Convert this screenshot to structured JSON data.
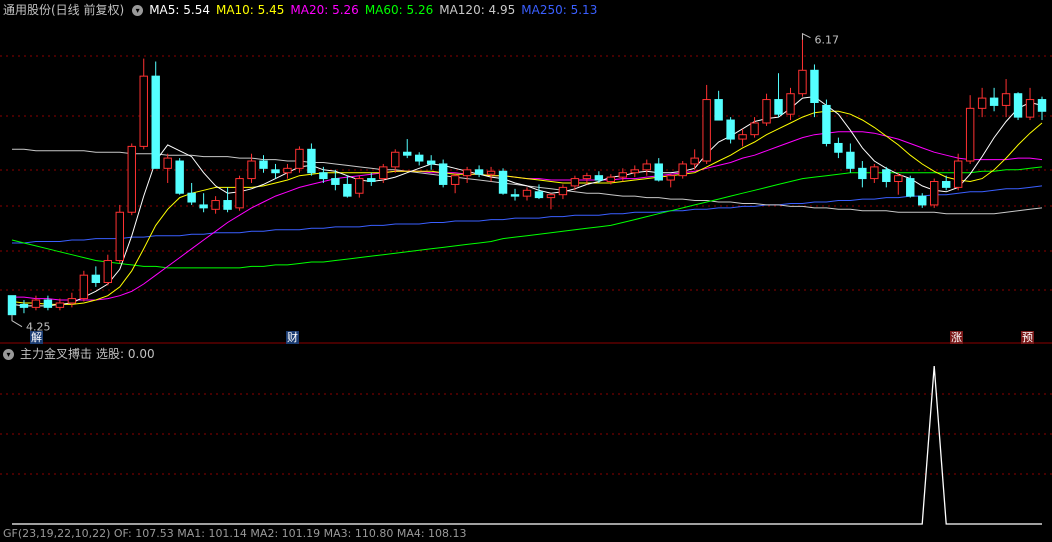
{
  "header": {
    "stock_title": "通用股份(日线 前复权)",
    "ma_labels": [
      {
        "text": "MA5: 5.54",
        "color": "#ffffff"
      },
      {
        "text": "MA10: 5.45",
        "color": "#ffff00"
      },
      {
        "text": "MA20: 5.26",
        "color": "#ff00ff"
      },
      {
        "text": "MA60: 5.26",
        "color": "#00ff00"
      },
      {
        "text": "MA120: 4.95",
        "color": "#c8c8c8"
      },
      {
        "text": "MA250: 5.13",
        "color": "#3a5fff"
      }
    ]
  },
  "indicator": {
    "title": "主力金叉搏击",
    "value_text": "选股: 0.00"
  },
  "bottom_text": "GF(23,19,22,10,22)  OF: 107.53  MA1: 101.14  MA2: 101.19  MA3: 110.80  MA4: 108.13",
  "markers": {
    "jie": "解",
    "cai": "财",
    "zhang": "涨",
    "yu": "预"
  },
  "chart_data": {
    "type": "candlestick",
    "price_high_label": "6.17",
    "price_low_label": "4.25",
    "ylim": [
      4.2,
      6.25
    ],
    "colors": {
      "up": "#ff3232",
      "down": "#54ffff",
      "ma5": "#ffffff",
      "ma10": "#ffff00",
      "ma20": "#ff00ff",
      "ma60": "#00ff00",
      "ma120": "#c8c8c8",
      "ma250": "#3a5fff",
      "grid": "#8b0000"
    },
    "candles": [
      [
        4.38,
        4.38,
        4.25,
        4.25
      ],
      [
        4.32,
        4.35,
        4.26,
        4.3
      ],
      [
        4.3,
        4.38,
        4.28,
        4.35
      ],
      [
        4.35,
        4.38,
        4.28,
        4.3
      ],
      [
        4.3,
        4.36,
        4.28,
        4.33
      ],
      [
        4.33,
        4.4,
        4.3,
        4.36
      ],
      [
        4.36,
        4.55,
        4.34,
        4.52
      ],
      [
        4.52,
        4.58,
        4.44,
        4.47
      ],
      [
        4.47,
        4.66,
        4.45,
        4.62
      ],
      [
        4.62,
        5.0,
        4.6,
        4.95
      ],
      [
        4.95,
        5.42,
        4.93,
        5.4
      ],
      [
        5.4,
        6.0,
        5.38,
        5.88
      ],
      [
        5.88,
        5.98,
        5.25,
        5.25
      ],
      [
        5.25,
        5.35,
        5.15,
        5.32
      ],
      [
        5.3,
        5.32,
        5.07,
        5.08
      ],
      [
        5.08,
        5.15,
        5.0,
        5.02
      ],
      [
        5.0,
        5.08,
        4.95,
        4.98
      ],
      [
        4.97,
        5.06,
        4.94,
        5.03
      ],
      [
        5.03,
        5.12,
        4.95,
        4.97
      ],
      [
        4.98,
        5.2,
        4.96,
        5.18
      ],
      [
        5.18,
        5.35,
        5.15,
        5.3
      ],
      [
        5.3,
        5.34,
        5.22,
        5.25
      ],
      [
        5.24,
        5.28,
        5.18,
        5.22
      ],
      [
        5.22,
        5.28,
        5.18,
        5.25
      ],
      [
        5.25,
        5.4,
        5.22,
        5.38
      ],
      [
        5.38,
        5.42,
        5.2,
        5.22
      ],
      [
        5.22,
        5.26,
        5.15,
        5.18
      ],
      [
        5.18,
        5.24,
        5.1,
        5.14
      ],
      [
        5.14,
        5.2,
        5.05,
        5.06
      ],
      [
        5.08,
        5.2,
        5.05,
        5.18
      ],
      [
        5.18,
        5.22,
        5.13,
        5.16
      ],
      [
        5.18,
        5.28,
        5.15,
        5.26
      ],
      [
        5.26,
        5.38,
        5.22,
        5.36
      ],
      [
        5.36,
        5.45,
        5.32,
        5.34
      ],
      [
        5.34,
        5.36,
        5.27,
        5.3
      ],
      [
        5.3,
        5.34,
        5.24,
        5.28
      ],
      [
        5.28,
        5.31,
        5.12,
        5.14
      ],
      [
        5.14,
        5.22,
        5.08,
        5.2
      ],
      [
        5.2,
        5.26,
        5.15,
        5.24
      ],
      [
        5.24,
        5.27,
        5.19,
        5.21
      ],
      [
        5.21,
        5.26,
        5.16,
        5.23
      ],
      [
        5.23,
        5.25,
        5.07,
        5.08
      ],
      [
        5.07,
        5.11,
        5.03,
        5.06
      ],
      [
        5.06,
        5.12,
        5.03,
        5.1
      ],
      [
        5.09,
        5.14,
        5.04,
        5.05
      ],
      [
        5.05,
        5.08,
        4.97,
        5.07
      ],
      [
        5.07,
        5.14,
        5.04,
        5.12
      ],
      [
        5.13,
        5.2,
        5.1,
        5.18
      ],
      [
        5.18,
        5.22,
        5.14,
        5.2
      ],
      [
        5.2,
        5.23,
        5.15,
        5.17
      ],
      [
        5.16,
        5.21,
        5.14,
        5.19
      ],
      [
        5.19,
        5.25,
        5.16,
        5.22
      ],
      [
        5.22,
        5.27,
        5.19,
        5.24
      ],
      [
        5.24,
        5.31,
        5.2,
        5.28
      ],
      [
        5.28,
        5.32,
        5.16,
        5.17
      ],
      [
        5.17,
        5.21,
        5.12,
        5.2
      ],
      [
        5.2,
        5.3,
        5.18,
        5.28
      ],
      [
        5.28,
        5.38,
        5.24,
        5.32
      ],
      [
        5.3,
        5.82,
        5.28,
        5.72
      ],
      [
        5.72,
        5.78,
        5.58,
        5.58
      ],
      [
        5.58,
        5.6,
        5.42,
        5.45
      ],
      [
        5.45,
        5.52,
        5.4,
        5.48
      ],
      [
        5.48,
        5.6,
        5.46,
        5.56
      ],
      [
        5.56,
        5.76,
        5.54,
        5.72
      ],
      [
        5.72,
        5.9,
        5.6,
        5.62
      ],
      [
        5.62,
        5.8,
        5.58,
        5.76
      ],
      [
        5.76,
        6.17,
        5.74,
        5.92
      ],
      [
        5.92,
        5.96,
        5.6,
        5.7
      ],
      [
        5.68,
        5.72,
        5.4,
        5.42
      ],
      [
        5.42,
        5.46,
        5.32,
        5.36
      ],
      [
        5.36,
        5.42,
        5.22,
        5.25
      ],
      [
        5.25,
        5.3,
        5.12,
        5.18
      ],
      [
        5.18,
        5.28,
        5.15,
        5.26
      ],
      [
        5.24,
        5.26,
        5.12,
        5.16
      ],
      [
        5.16,
        5.22,
        5.07,
        5.2
      ],
      [
        5.18,
        5.2,
        5.05,
        5.06
      ],
      [
        5.06,
        5.08,
        4.98,
        5.0
      ],
      [
        5.0,
        5.18,
        4.98,
        5.16
      ],
      [
        5.16,
        5.2,
        5.1,
        5.12
      ],
      [
        5.12,
        5.35,
        5.1,
        5.3
      ],
      [
        5.3,
        5.75,
        5.28,
        5.66
      ],
      [
        5.66,
        5.8,
        5.6,
        5.73
      ],
      [
        5.73,
        5.8,
        5.64,
        5.68
      ],
      [
        5.68,
        5.86,
        5.6,
        5.76
      ],
      [
        5.76,
        5.77,
        5.58,
        5.6
      ],
      [
        5.6,
        5.8,
        5.58,
        5.72
      ],
      [
        5.72,
        5.74,
        5.58,
        5.64
      ]
    ],
    "ma_series": {
      "ma5": [
        4.32,
        4.31,
        4.31,
        4.31,
        4.32,
        4.33,
        4.37,
        4.41,
        4.46,
        4.56,
        4.79,
        5.06,
        5.3,
        5.41,
        5.37,
        5.33,
        5.22,
        5.13,
        5.08,
        5.09,
        5.11,
        5.14,
        5.18,
        5.22,
        5.26,
        5.27,
        5.24,
        5.23,
        5.2,
        5.17,
        5.16,
        5.17,
        5.19,
        5.22,
        5.25,
        5.28,
        5.27,
        5.25,
        5.23,
        5.21,
        5.19,
        5.18,
        5.15,
        5.13,
        5.1,
        5.08,
        5.09,
        5.11,
        5.14,
        5.16,
        5.19,
        5.2,
        5.22,
        5.23,
        5.22,
        5.22,
        5.23,
        5.25,
        5.35,
        5.43,
        5.47,
        5.52,
        5.57,
        5.59,
        5.6,
        5.66,
        5.73,
        5.74,
        5.68,
        5.62,
        5.51,
        5.39,
        5.3,
        5.25,
        5.21,
        5.18,
        5.13,
        5.1,
        5.09,
        5.12,
        5.21,
        5.33,
        5.46,
        5.57,
        5.66,
        5.7,
        5.68
      ],
      "ma10": [
        4.34,
        4.33,
        4.33,
        4.32,
        4.32,
        4.32,
        4.33,
        4.35,
        4.38,
        4.44,
        4.55,
        4.7,
        4.86,
        4.97,
        5.05,
        5.08,
        5.1,
        5.12,
        5.12,
        5.12,
        5.12,
        5.13,
        5.15,
        5.17,
        5.2,
        5.21,
        5.22,
        5.22,
        5.22,
        5.22,
        5.22,
        5.22,
        5.23,
        5.23,
        5.23,
        5.23,
        5.22,
        5.21,
        5.21,
        5.21,
        5.2,
        5.2,
        5.19,
        5.18,
        5.17,
        5.16,
        5.15,
        5.15,
        5.15,
        5.15,
        5.15,
        5.16,
        5.17,
        5.18,
        5.19,
        5.2,
        5.21,
        5.22,
        5.26,
        5.3,
        5.34,
        5.39,
        5.43,
        5.48,
        5.52,
        5.56,
        5.6,
        5.63,
        5.64,
        5.64,
        5.62,
        5.58,
        5.53,
        5.47,
        5.41,
        5.34,
        5.28,
        5.23,
        5.19,
        5.17,
        5.16,
        5.18,
        5.24,
        5.32,
        5.41,
        5.49,
        5.56
      ],
      "ma20": [
        4.37,
        4.37,
        4.36,
        4.36,
        4.35,
        4.35,
        4.35,
        4.35,
        4.36,
        4.38,
        4.41,
        4.46,
        4.52,
        4.58,
        4.64,
        4.7,
        4.76,
        4.82,
        4.88,
        4.93,
        4.98,
        5.02,
        5.06,
        5.09,
        5.12,
        5.14,
        5.16,
        5.18,
        5.19,
        5.2,
        5.21,
        5.22,
        5.23,
        5.23,
        5.23,
        5.22,
        5.22,
        5.22,
        5.21,
        5.21,
        5.2,
        5.2,
        5.19,
        5.18,
        5.18,
        5.17,
        5.17,
        5.17,
        5.17,
        5.17,
        5.17,
        5.18,
        5.18,
        5.19,
        5.2,
        5.21,
        5.22,
        5.23,
        5.25,
        5.27,
        5.29,
        5.32,
        5.34,
        5.37,
        5.4,
        5.43,
        5.46,
        5.48,
        5.49,
        5.5,
        5.5,
        5.5,
        5.49,
        5.47,
        5.45,
        5.42,
        5.39,
        5.36,
        5.34,
        5.32,
        5.31,
        5.31,
        5.31,
        5.31,
        5.32,
        5.32,
        5.31
      ],
      "ma60": [
        4.76,
        4.74,
        4.72,
        4.7,
        4.68,
        4.66,
        4.64,
        4.62,
        4.61,
        4.6,
        4.59,
        4.58,
        4.58,
        4.57,
        4.57,
        4.57,
        4.57,
        4.57,
        4.57,
        4.57,
        4.58,
        4.58,
        4.59,
        4.59,
        4.6,
        4.61,
        4.61,
        4.62,
        4.63,
        4.64,
        4.65,
        4.66,
        4.67,
        4.68,
        4.69,
        4.7,
        4.71,
        4.72,
        4.73,
        4.74,
        4.75,
        4.77,
        4.78,
        4.79,
        4.8,
        4.81,
        4.82,
        4.83,
        4.84,
        4.85,
        4.86,
        4.88,
        4.9,
        4.92,
        4.94,
        4.96,
        4.98,
        5.0,
        5.02,
        5.04,
        5.06,
        5.08,
        5.1,
        5.12,
        5.14,
        5.16,
        5.18,
        5.19,
        5.2,
        5.21,
        5.22,
        5.22,
        5.22,
        5.22,
        5.22,
        5.22,
        5.22,
        5.22,
        5.22,
        5.22,
        5.22,
        5.23,
        5.23,
        5.24,
        5.24,
        5.25,
        5.26
      ],
      "ma120": [
        5.38,
        5.38,
        5.37,
        5.37,
        5.37,
        5.37,
        5.37,
        5.36,
        5.36,
        5.36,
        5.35,
        5.35,
        5.35,
        5.34,
        5.34,
        5.34,
        5.33,
        5.33,
        5.33,
        5.32,
        5.32,
        5.31,
        5.31,
        5.3,
        5.3,
        5.29,
        5.29,
        5.28,
        5.27,
        5.26,
        5.25,
        5.24,
        5.24,
        5.23,
        5.22,
        5.21,
        5.2,
        5.19,
        5.18,
        5.17,
        5.16,
        5.15,
        5.14,
        5.13,
        5.12,
        5.11,
        5.1,
        5.09,
        5.08,
        5.08,
        5.07,
        5.06,
        5.06,
        5.05,
        5.05,
        5.04,
        5.04,
        5.03,
        5.03,
        5.02,
        5.02,
        5.01,
        5.01,
        5.0,
        5.0,
        4.99,
        4.99,
        4.98,
        4.98,
        4.97,
        4.97,
        4.96,
        4.96,
        4.96,
        4.95,
        4.95,
        4.95,
        4.95,
        4.94,
        4.94,
        4.94,
        4.94,
        4.94,
        4.95,
        4.96,
        4.97,
        4.98
      ],
      "ma250": [
        4.74,
        4.74,
        4.75,
        4.75,
        4.75,
        4.76,
        4.76,
        4.77,
        4.77,
        4.77,
        4.78,
        4.78,
        4.79,
        4.79,
        4.79,
        4.8,
        4.8,
        4.81,
        4.81,
        4.81,
        4.82,
        4.82,
        4.83,
        4.83,
        4.83,
        4.84,
        4.84,
        4.85,
        4.85,
        4.85,
        4.86,
        4.86,
        4.87,
        4.87,
        4.87,
        4.88,
        4.88,
        4.89,
        4.89,
        4.89,
        4.9,
        4.9,
        4.91,
        4.91,
        4.91,
        4.92,
        4.92,
        4.93,
        4.93,
        4.93,
        4.94,
        4.94,
        4.95,
        4.95,
        4.95,
        4.96,
        4.96,
        4.97,
        4.97,
        4.98,
        4.98,
        4.99,
        4.99,
        5.0,
        5.0,
        5.01,
        5.01,
        5.02,
        5.02,
        5.03,
        5.03,
        5.04,
        5.04,
        5.05,
        5.05,
        5.06,
        5.06,
        5.07,
        5.07,
        5.08,
        5.09,
        5.09,
        5.1,
        5.11,
        5.11,
        5.12,
        5.13
      ]
    },
    "indicator_series": [
      0,
      0,
      0,
      0,
      0,
      0,
      0,
      0,
      0,
      0,
      0,
      0,
      0,
      0,
      0,
      0,
      0,
      0,
      0,
      0,
      0,
      0,
      0,
      0,
      0,
      0,
      0,
      0,
      0,
      0,
      0,
      0,
      0,
      0,
      0,
      0,
      0,
      0,
      0,
      0,
      0,
      0,
      0,
      0,
      0,
      0,
      0,
      0,
      0,
      0,
      0,
      0,
      0,
      0,
      0,
      0,
      0,
      0,
      0,
      0,
      0,
      0,
      0,
      0,
      0,
      0,
      0,
      0,
      0,
      0,
      0,
      0,
      0,
      0,
      0,
      0,
      0,
      1,
      0,
      0,
      0,
      0,
      0,
      0,
      0,
      0,
      0
    ],
    "indicator_ylim": [
      0,
      1
    ]
  }
}
